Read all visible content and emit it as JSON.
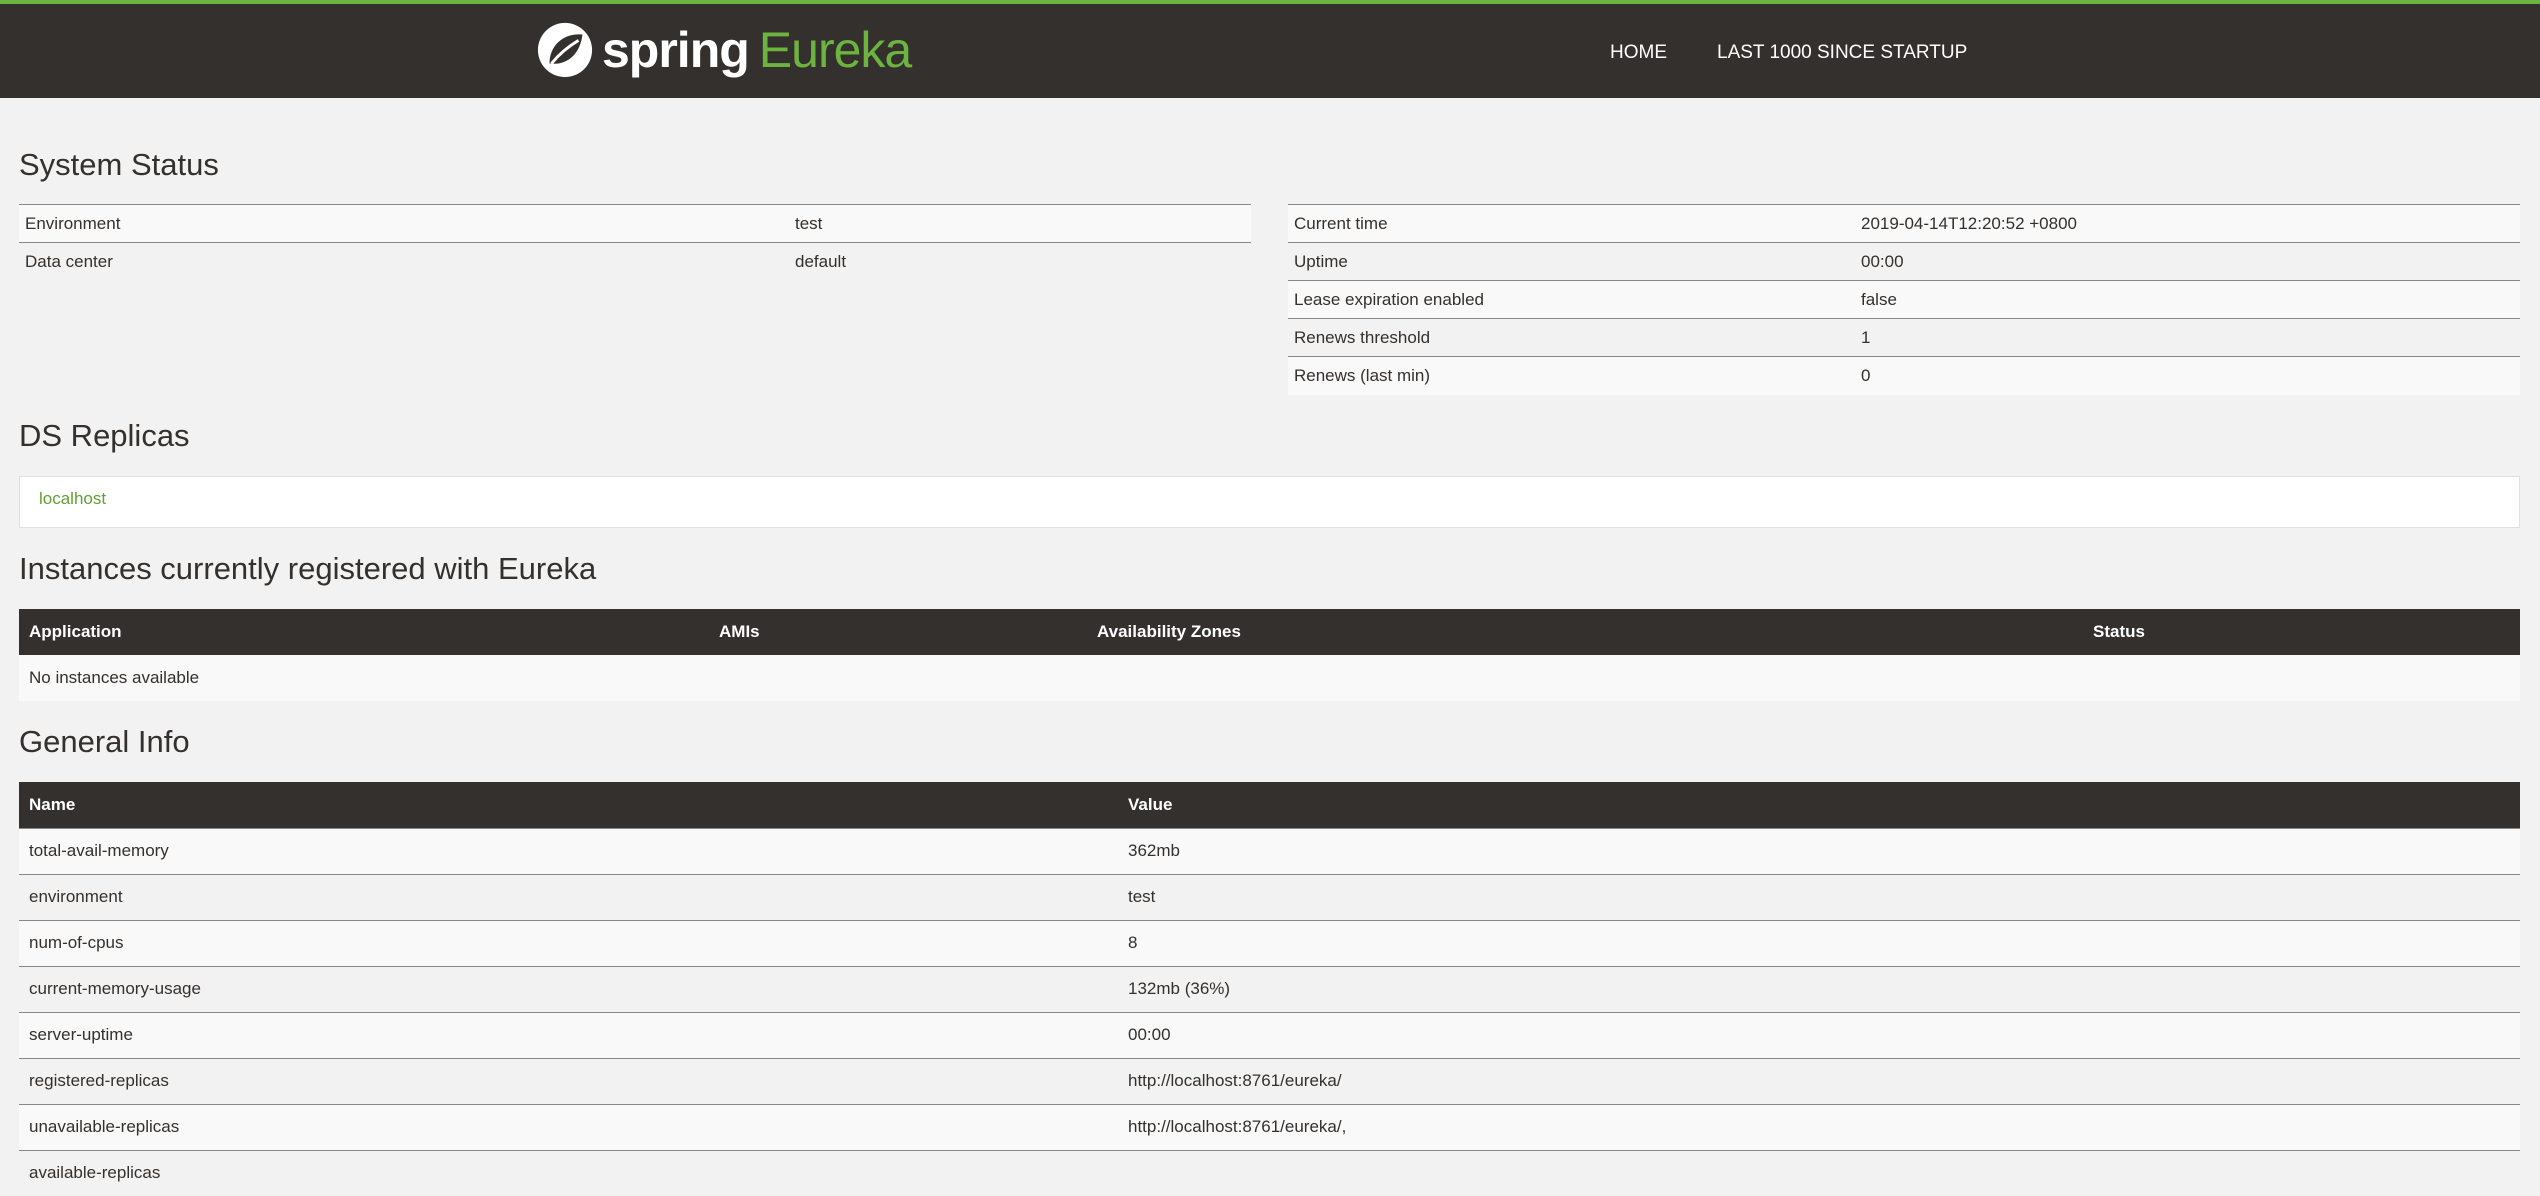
{
  "nav": {
    "brand_spring": "spring",
    "brand_eureka": "Eureka",
    "links": [
      "HOME",
      "LAST 1000 SINCE STARTUP"
    ]
  },
  "system_status": {
    "title": "System Status",
    "left": [
      {
        "key": "Environment",
        "value": "test"
      },
      {
        "key": "Data center",
        "value": "default"
      }
    ],
    "right": [
      {
        "key": "Current time",
        "value": "2019-04-14T12:20:52 +0800"
      },
      {
        "key": "Uptime",
        "value": "00:00"
      },
      {
        "key": "Lease expiration enabled",
        "value": "false"
      },
      {
        "key": "Renews threshold",
        "value": "1"
      },
      {
        "key": "Renews (last min)",
        "value": "0"
      }
    ]
  },
  "ds_replicas": {
    "title": "DS Replicas",
    "items": [
      "localhost"
    ]
  },
  "instances": {
    "title": "Instances currently registered with Eureka",
    "headers": [
      "Application",
      "AMIs",
      "Availability Zones",
      "Status"
    ],
    "empty_text": "No instances available"
  },
  "general_info": {
    "title": "General Info",
    "headers": [
      "Name",
      "Value"
    ],
    "rows": [
      {
        "name": "total-avail-memory",
        "value": "362mb"
      },
      {
        "name": "environment",
        "value": "test"
      },
      {
        "name": "num-of-cpus",
        "value": "8"
      },
      {
        "name": "current-memory-usage",
        "value": "132mb (36%)"
      },
      {
        "name": "server-uptime",
        "value": "00:00"
      },
      {
        "name": "registered-replicas",
        "value": "http://localhost:8761/eureka/"
      },
      {
        "name": "unavailable-replicas",
        "value": "http://localhost:8761/eureka/,"
      },
      {
        "name": "available-replicas",
        "value": ""
      }
    ]
  },
  "colors": {
    "nav_bg": "#34302d",
    "accent_green": "#6db33f",
    "page_bg": "#f2f2f2"
  }
}
